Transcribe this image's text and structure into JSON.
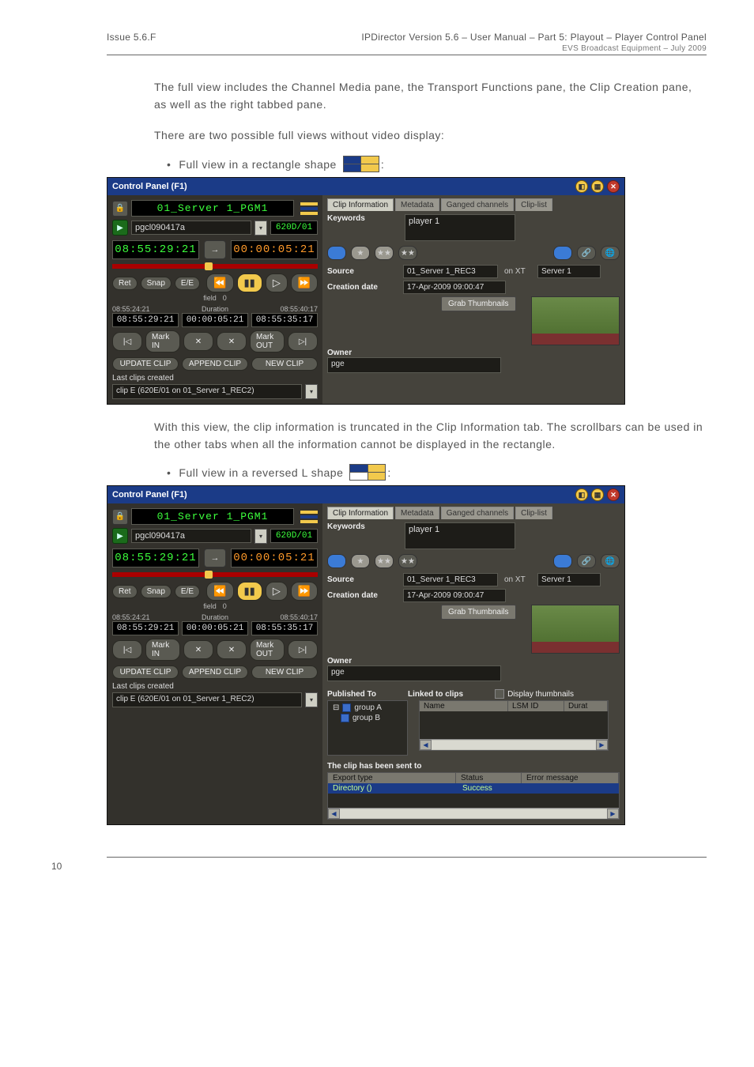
{
  "header": {
    "issue": "Issue 5.6.F",
    "title": "IPDirector Version 5.6 – User Manual – Part 5: Playout – Player Control Panel",
    "sub": "EVS Broadcast Equipment – July 2009"
  },
  "para1": "The full view includes the Channel Media pane, the Transport Functions pane, the Clip Creation pane, as well as the right tabbed pane.",
  "para2": "There are two possible full views without video display:",
  "bullet1": "Full view in a rectangle shape",
  "bullet2": "Full view in a reversed L shape",
  "para3": "With this view, the clip information is truncated in the Clip Information tab. The scrollbars can be used in the other tabs when all the information cannot be displayed in the rectangle.",
  "app": {
    "title": "Control Panel (F1)",
    "channel": "01_Server 1_PGM1",
    "clip_name": "pgcl090417a",
    "lsm_id": "620D/01",
    "tc_left": "08:55:29:21",
    "tc_right": "00:00:05:21",
    "btn_ret": "Ret",
    "btn_snap": "Snap",
    "btn_ee": "E/E",
    "speed_field": "field",
    "speed_zero": "0",
    "time_in": "08:55:24:21",
    "time_dur_label": "Duration",
    "time_out": "08:55:40:17",
    "box_in": "08:55:29:21",
    "box_dur": "00:00:05:21",
    "box_out": "08:55:35:17",
    "mark_in": "Mark IN",
    "mark_out": "Mark OUT",
    "update": "UPDATE CLIP",
    "append": "APPEND CLIP",
    "newclip": "NEW CLIP",
    "last_label": "Last clips created",
    "last_clip": "clip E (620E/01 on 01_Server 1_REC2)",
    "tabs": [
      "Clip Information",
      "Metadata",
      "Ganged channels",
      "Clip-list"
    ],
    "keywords_label": "Keywords",
    "keywords_value": "player 1",
    "source_label": "Source",
    "source_value": "01_Server 1_REC3",
    "onxt": "on XT",
    "server": "Server 1",
    "creation_label": "Creation date",
    "creation_value": "17-Apr-2009 09:00:47",
    "grab": "Grab Thumbnails",
    "owner_label": "Owner",
    "owner_value": "pge",
    "pub_label": "Published To",
    "linked_label": "Linked to clips",
    "display_thumb": "Display thumbnails",
    "groupA": "group A",
    "groupB": "group B",
    "col_name": "Name",
    "col_lsm": "LSM ID",
    "col_dur": "Durat",
    "sent_label": "The clip has been sent to",
    "col_export": "Export type",
    "col_status": "Status",
    "col_err": "Error message",
    "row_export": "Directory ()",
    "row_status": "Success"
  },
  "footer": {
    "page": "10"
  }
}
